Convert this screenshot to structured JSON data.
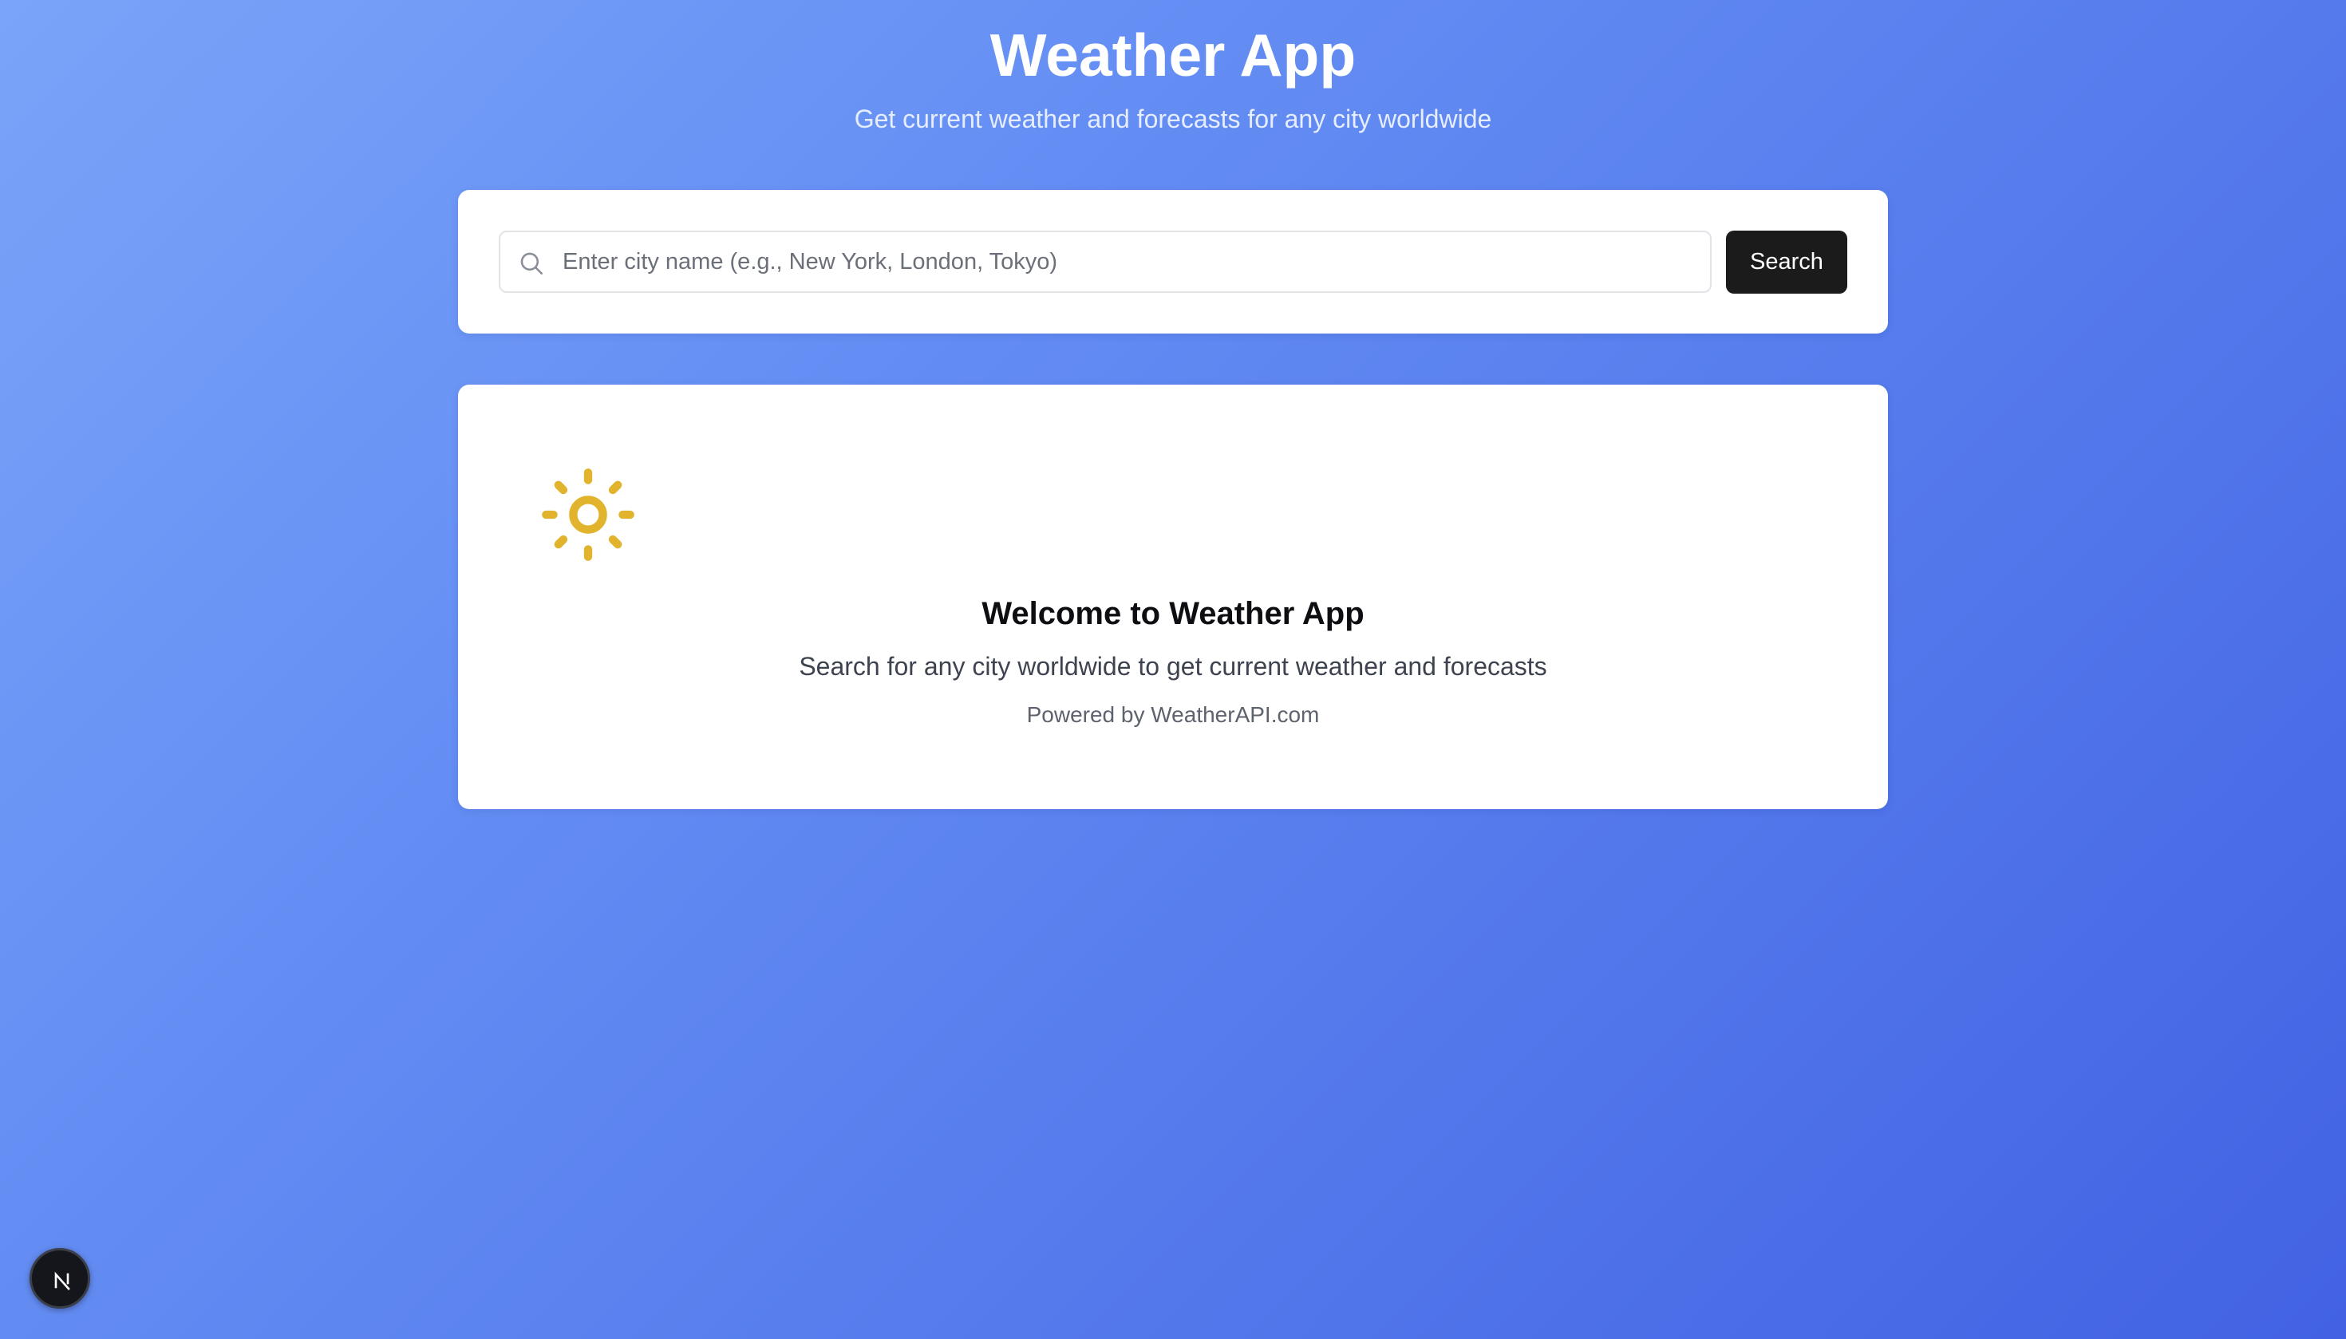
{
  "header": {
    "title": "Weather App",
    "subtitle": "Get current weather and forecasts for any city worldwide"
  },
  "search": {
    "placeholder": "Enter city name (e.g., New York, London, Tokyo)",
    "value": "",
    "button_label": "Search",
    "icon": "search-icon"
  },
  "welcome": {
    "icon": "sun-icon",
    "title": "Welcome to Weather App",
    "text": "Search for any city worldwide to get current weather and forecasts",
    "powered_by": "Powered by WeatherAPI.com"
  },
  "dev_badge": {
    "icon": "nextjs-logo-icon",
    "logo_letter": "N"
  },
  "colors": {
    "background_start": "#7aa4f8",
    "background_end": "#4262e3",
    "sun": "#e2b32c",
    "button": "#1b1b1b",
    "card": "#ffffff"
  }
}
